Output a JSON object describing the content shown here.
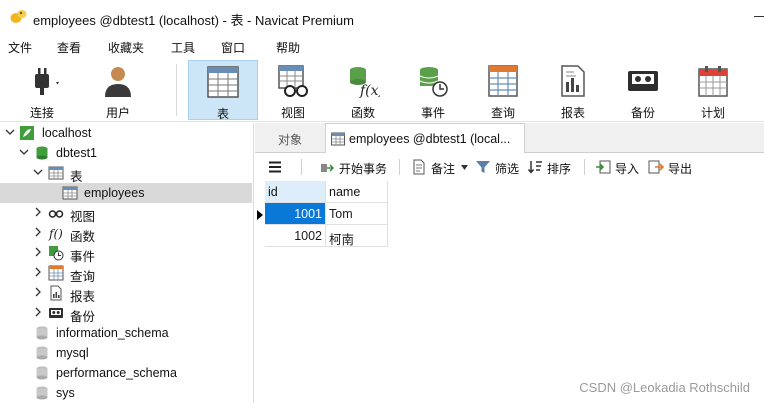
{
  "window": {
    "title": "employees @dbtest1 (localhost) - 表 - Navicat Premium"
  },
  "menu": [
    "文件",
    "查看",
    "收藏夹",
    "工具",
    "窗口",
    "帮助"
  ],
  "toolbar": {
    "connect": "连接",
    "user": "用户",
    "table": "表",
    "view": "视图",
    "function": "函数",
    "event": "事件",
    "query": "查询",
    "report": "报表",
    "backup": "备份",
    "schedule": "计划"
  },
  "tree": {
    "connection": "localhost",
    "database": "dbtest1",
    "tables_node": "表",
    "table": "employees",
    "views": "视图",
    "functions": "函数",
    "events": "事件",
    "queries": "查询",
    "reports": "报表",
    "backups": "备份",
    "other_dbs": [
      "information_schema",
      "mysql",
      "performance_schema",
      "sys"
    ]
  },
  "tabs": {
    "objects": "对象",
    "active": "employees @dbtest1 (local..."
  },
  "grid_toolbar": {
    "begin_transaction": "开始事务",
    "note": "备注",
    "filter": "筛选",
    "sort": "排序",
    "import": "导入",
    "export": "导出"
  },
  "grid": {
    "columns": [
      "id",
      "name"
    ],
    "rows": [
      {
        "id": "1001",
        "name": "Tom"
      },
      {
        "id": "1002",
        "name": "柯南"
      }
    ]
  },
  "watermark": "CSDN @Leokadia Rothschild",
  "colors": {
    "selection": "#0a78d7",
    "active_tool": "#cde6f7",
    "tree_selected": "#d9d9d9"
  }
}
